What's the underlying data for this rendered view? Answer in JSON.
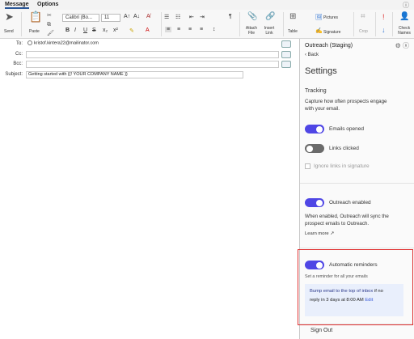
{
  "tabs": [
    "Message",
    "Options"
  ],
  "ribbon": {
    "send": "Send",
    "paste": "Paste",
    "font": "Calibri (Bo...",
    "size": "11",
    "attach": "Attach File",
    "insert_link": "Insert Link",
    "table": "Table",
    "pictures": "Pictures",
    "signature": "Signature",
    "crop": "Crop",
    "check_names": "Check Names"
  },
  "header": {
    "to_label": "To:",
    "to_value": "kristof.kintera22@mailinator.com",
    "cc_label": "Cc:",
    "bcc_label": "Bcc:",
    "subject_label": "Subject:",
    "subject_value": "Getting started with {{! YOUR COMPANY NAME }}"
  },
  "panel": {
    "title": "Outreach (Staging)",
    "back": "Back",
    "heading": "Settings",
    "tracking": "Tracking",
    "tracking_desc1": "Capture how often prospects engage",
    "tracking_desc2": "with your email.",
    "emails_opened": "Emails opened",
    "links_clicked": "Links clicked",
    "ignore_links": "Ignore links in signature",
    "outreach_enabled": "Outreach enabled",
    "enabled_desc1": "When enabled, Outreach will sync the",
    "enabled_desc2": "prospect emails to Outreach.",
    "learn_more": "Learn more",
    "auto_reminders": "Automatic reminders",
    "reminder_desc": "Set a reminder for all your emails",
    "bump1": "Bump email to the top of inbox",
    "bump1b": " if no",
    "bump2": "reply in 3 days at 8:00 AM",
    "bump2b": " Edit",
    "sign_out": "Sign Out"
  },
  "colors": {
    "accent": "#4f46e5",
    "highlight": "#e03030",
    "info_bg": "#e9effc"
  },
  "toggles": {
    "emails_opened": true,
    "links_clicked": false,
    "ignore_links": false,
    "outreach_enabled": true,
    "auto_reminders": true
  }
}
